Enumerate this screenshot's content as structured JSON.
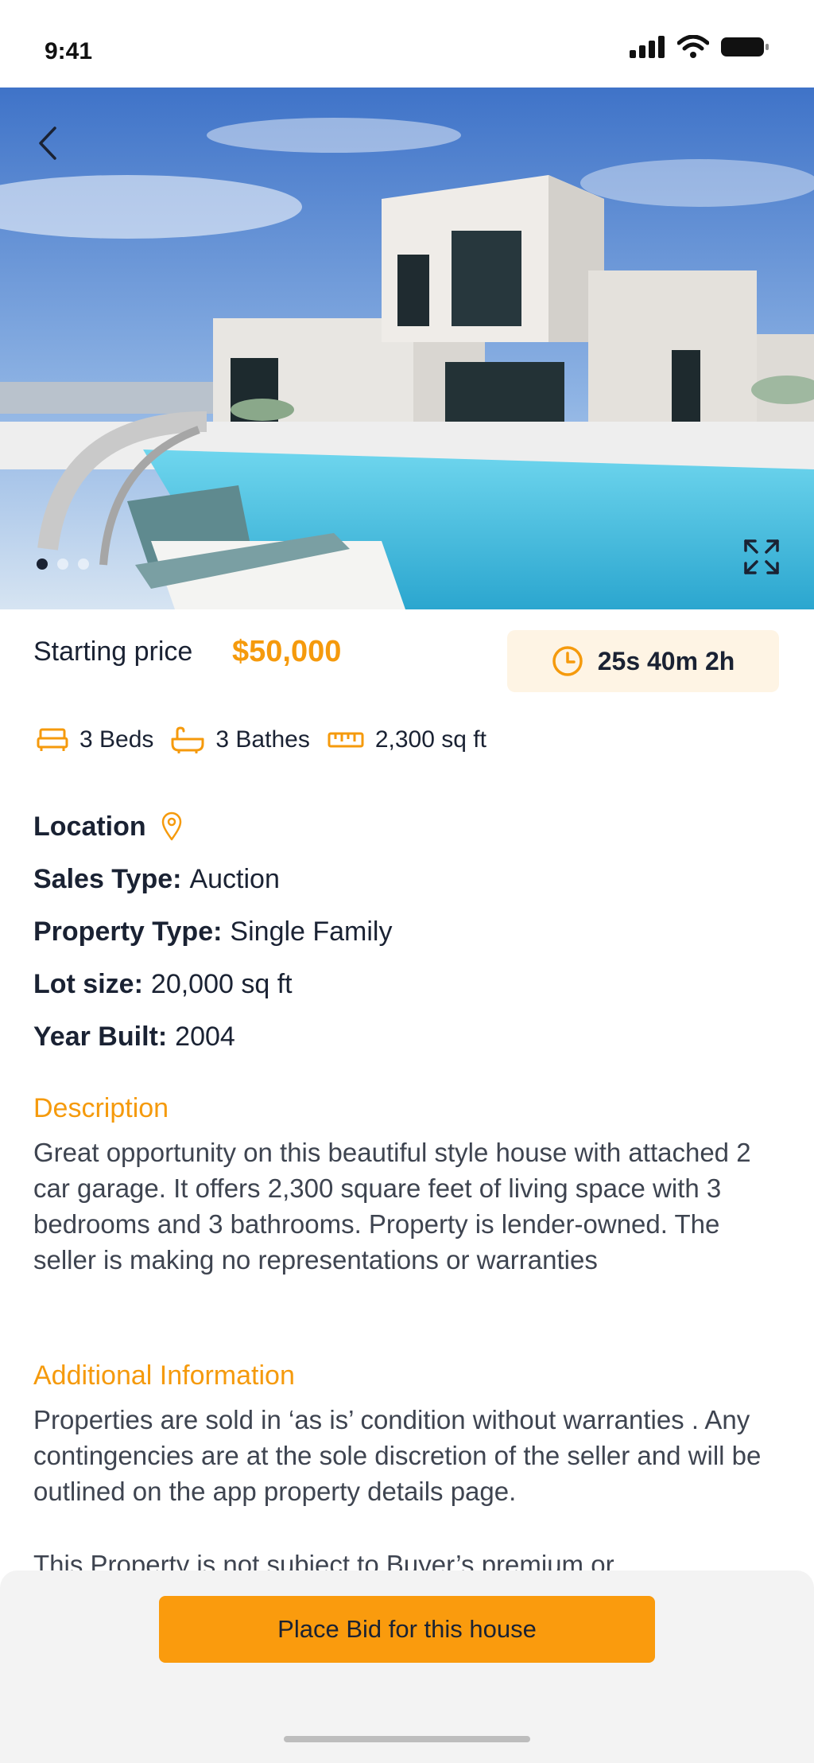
{
  "status_bar": {
    "time": "9:41"
  },
  "hero": {
    "image_alt": "Modern white house with swimming pool",
    "total_slides": 3,
    "active_slide": 1
  },
  "price": {
    "label": "Starting price",
    "value": "$50,000",
    "timer": "25s 40m 2h"
  },
  "features": [
    {
      "icon": "bed-icon",
      "label": "3 Beds"
    },
    {
      "icon": "bath-icon",
      "label": "3 Bathes"
    },
    {
      "icon": "ruler-icon",
      "label": "2,300 sq ft"
    }
  ],
  "details": {
    "location_label": "Location",
    "sales_type_label": "Sales Type:",
    "sales_type_value": "Auction",
    "property_type_label": "Property Type:",
    "property_type_value": "Single Family",
    "lot_size_label": "Lot size:",
    "lot_size_value": "20,000 sq ft",
    "year_built_label": "Year Built:",
    "year_built_value": "2004"
  },
  "description": {
    "title": "Description",
    "body": "Great opportunity on this beautiful style house with attached 2 car garage. It offers 2,300 square feet of living space with 3 bedrooms and 3 bathrooms. Property is lender-owned. The seller is making no representations or warranties"
  },
  "additional": {
    "title": "Additional Information",
    "body": "Properties are sold in ‘as is’ condition without warranties . Any contingencies are at the sole discretion of the seller and will be outlined on the app property details page.",
    "body2": "This Property is not subject to Buyer’s premium or"
  },
  "cta": {
    "bid_label": "Place Bid for this house"
  },
  "colors": {
    "accent": "#f59a0c",
    "text": "#1a2233",
    "timer_bg": "#fef4e4"
  }
}
